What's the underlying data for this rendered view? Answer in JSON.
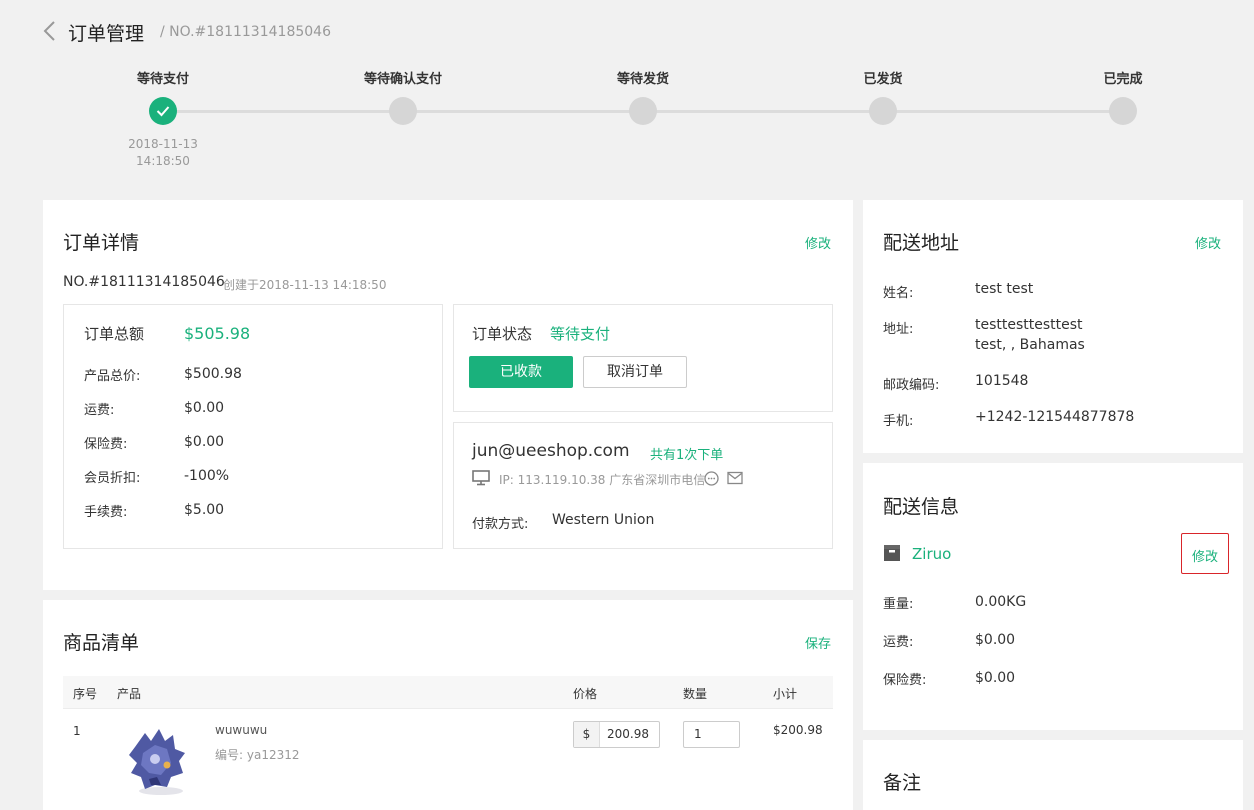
{
  "header": {
    "title": "订单管理",
    "order_no": "/ NO.#18111314185046"
  },
  "progress": {
    "steps": [
      {
        "label": "等待支付",
        "active": true
      },
      {
        "label": "等待确认支付",
        "active": false
      },
      {
        "label": "等待发货",
        "active": false
      },
      {
        "label": "已发货",
        "active": false
      },
      {
        "label": "已完成",
        "active": false
      }
    ],
    "first_step_date": "2018-11-13",
    "first_step_time": "14:18:50"
  },
  "order_details": {
    "title": "订单详情",
    "edit_label": "修改",
    "no": "NO.#18111314185046",
    "created": "创建于2018-11-13 14:18:50",
    "total_label": "订单总额",
    "total_value": "$505.98",
    "rows": [
      {
        "label": "产品总价:",
        "value": "$500.98"
      },
      {
        "label": "运费:",
        "value": "$0.00"
      },
      {
        "label": "保险费:",
        "value": "$0.00"
      },
      {
        "label": "会员折扣:",
        "value": "-100%"
      },
      {
        "label": "手续费:",
        "value": "$5.00"
      }
    ],
    "status_label": "订单状态",
    "status_value": "等待支付",
    "received_button": "已收款",
    "cancel_button": "取消订单",
    "email": "jun@ueeshop.com",
    "order_count": "共有1次下单",
    "ip_info": "IP: 113.119.10.38 广东省深圳市电信",
    "payment_label": "付款方式:",
    "payment_value": "Western Union"
  },
  "address": {
    "title": "配送地址",
    "edit_label": "修改",
    "name_label": "姓名:",
    "name_value": "test test",
    "addr_label": "地址:",
    "addr_line1": "testtesttesttest",
    "addr_line2": "test, , Bahamas",
    "zip_label": "邮政编码:",
    "zip_value": "101548",
    "phone_label": "手机:",
    "phone_value": "+1242-121544877878"
  },
  "shipping": {
    "title": "配送信息",
    "carrier": "Ziruo",
    "edit_label": "修改",
    "weight_label": "重量:",
    "weight_value": "0.00KG",
    "freight_label": "运费:",
    "freight_value": "$0.00",
    "insurance_label": "保险费:",
    "insurance_value": "$0.00"
  },
  "products": {
    "title": "商品清单",
    "save_label": "保存",
    "columns": [
      "序号",
      "产品",
      "价格",
      "数量",
      "小计"
    ],
    "rows": [
      {
        "index": "1",
        "name": "wuwuwu",
        "sku": "编号: ya12312",
        "currency": "$",
        "price": "200.98",
        "qty": "1",
        "subtotal": "$200.98"
      }
    ]
  },
  "notes": {
    "title": "备注"
  },
  "colors": {
    "accent": "#1ab17c",
    "inactive": "#d6d6d6"
  }
}
